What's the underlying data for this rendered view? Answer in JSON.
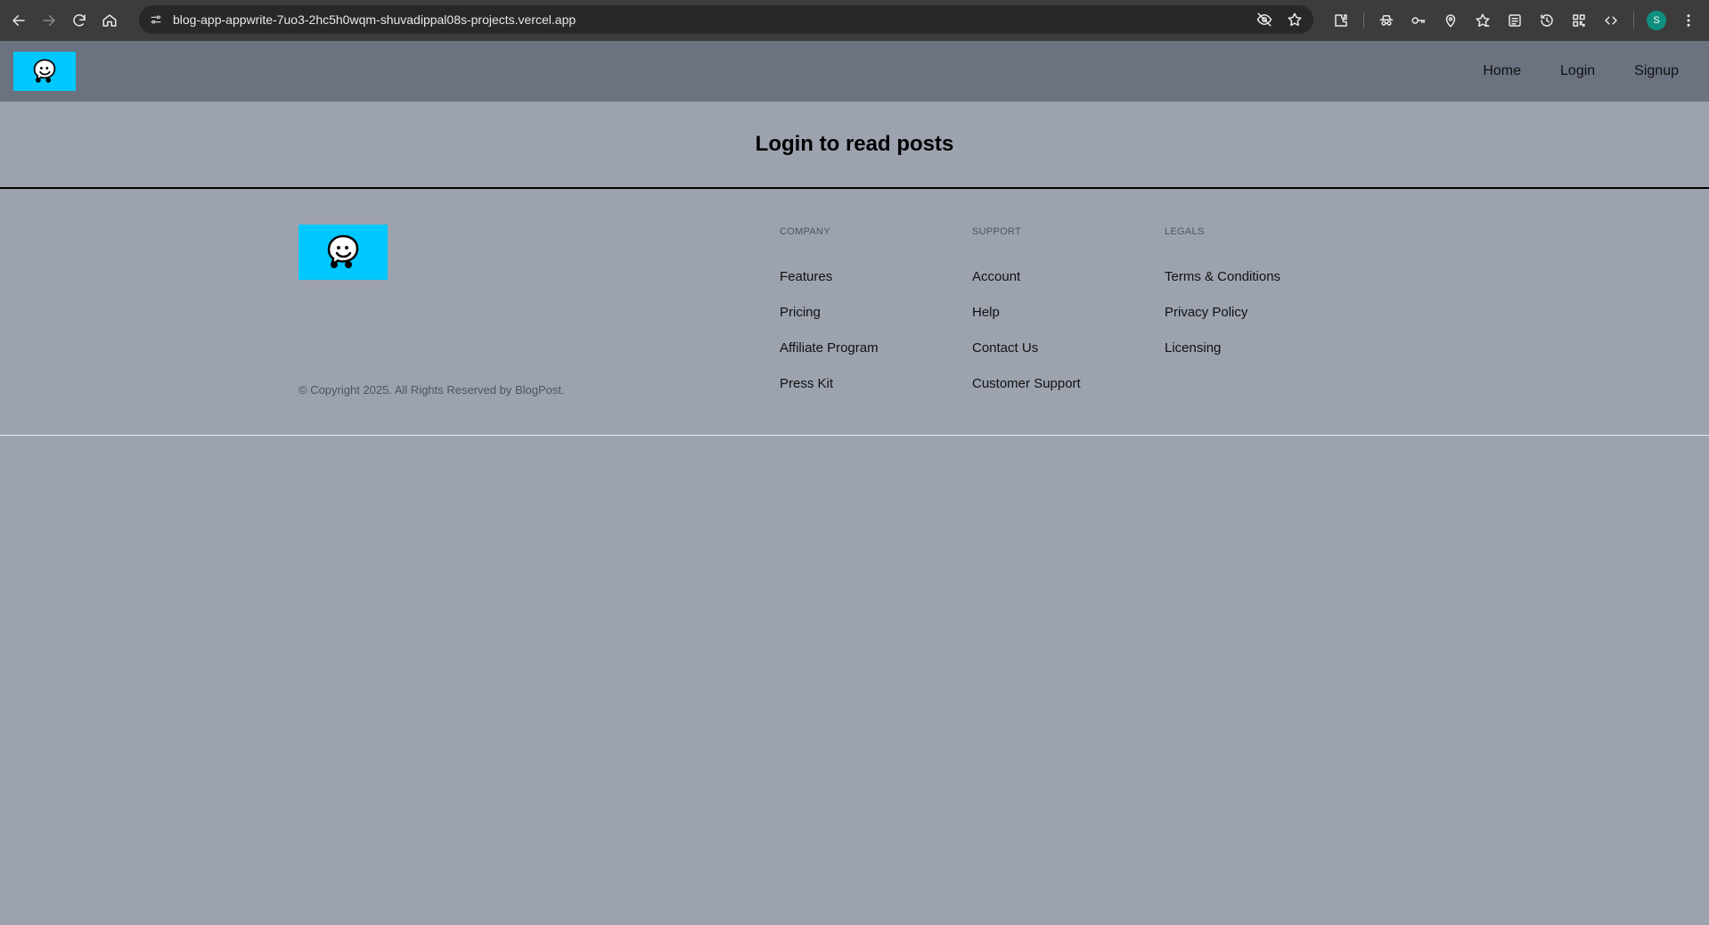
{
  "browser": {
    "url": "blog-app-appwrite-7uo3-2hc5h0wqm-shuvadippal08s-projects.vercel.app",
    "profile_initial": "S",
    "icons": [
      "back-icon",
      "forward-icon",
      "reload-icon",
      "home-icon",
      "site-info-icon",
      "eye-off-icon",
      "star-icon",
      "extensions-icon",
      "incognito-icon",
      "password-key-icon",
      "location-pin-icon",
      "bookmarks-icon",
      "reading-list-icon",
      "history-icon",
      "qr-code-icon",
      "devtools-icon",
      "more-icon"
    ]
  },
  "header": {
    "nav": [
      {
        "label": "Home"
      },
      {
        "label": "Login"
      },
      {
        "label": "Signup"
      }
    ]
  },
  "main": {
    "heading": "Login to read posts"
  },
  "footer": {
    "copyright": "© Copyright 2025. All Rights Reserved by BlogPost.",
    "columns": [
      {
        "title": "COMPANY",
        "links": [
          "Features",
          "Pricing",
          "Affiliate Program",
          "Press Kit"
        ]
      },
      {
        "title": "SUPPORT",
        "links": [
          "Account",
          "Help",
          "Contact Us",
          "Customer Support"
        ]
      },
      {
        "title": "LEGALS",
        "links": [
          "Terms & Conditions",
          "Privacy Policy",
          "Licensing"
        ]
      }
    ]
  },
  "colors": {
    "chrome": "#3c3c3c",
    "header_bg": "#6b7280",
    "page_bg": "#9ca3af",
    "logo_bg": "#00c8ff"
  }
}
